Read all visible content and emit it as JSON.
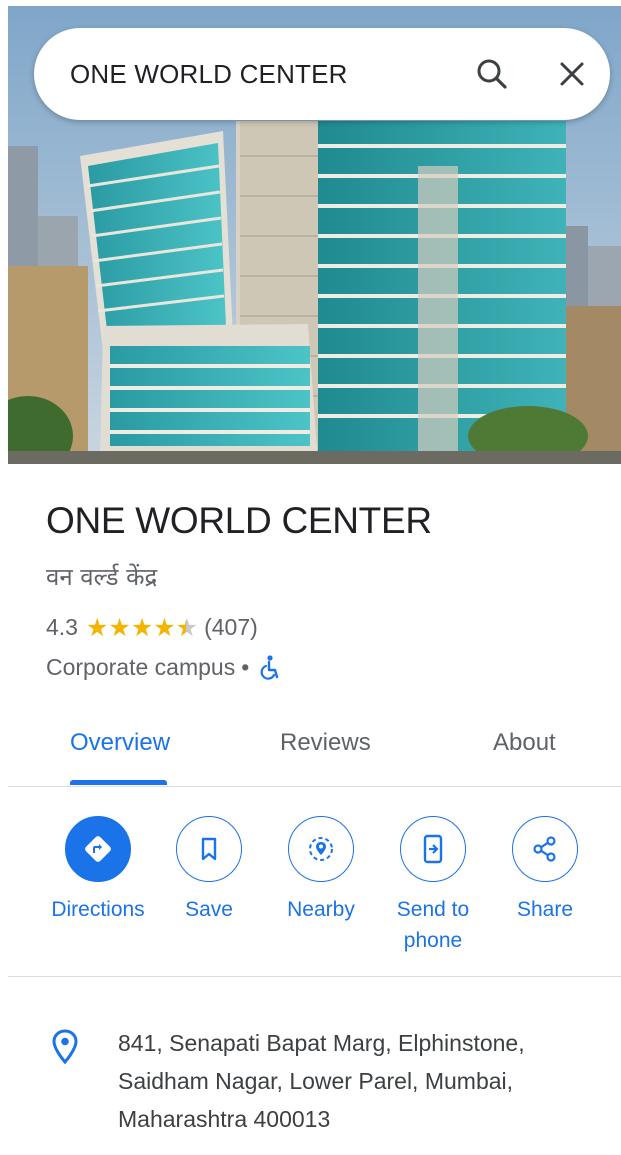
{
  "search": {
    "query": "ONE WORLD CENTER"
  },
  "place": {
    "name": "ONE WORLD CENTER",
    "local_name": "वन वर्ल्ड केंद्र",
    "rating": "4.3",
    "stars": 4.3,
    "review_count": "(407)",
    "category": "Corporate campus",
    "separator": "•",
    "wheelchair_accessible": true
  },
  "tabs": [
    {
      "label": "Overview",
      "active": true
    },
    {
      "label": "Reviews",
      "active": false
    },
    {
      "label": "About",
      "active": false
    }
  ],
  "actions": [
    {
      "label": "Directions",
      "icon": "directions-icon",
      "filled": true
    },
    {
      "label": "Save",
      "icon": "bookmark-icon",
      "filled": false
    },
    {
      "label": "Nearby",
      "icon": "nearby-icon",
      "filled": false
    },
    {
      "label": "Send to phone",
      "icon": "send-to-phone-icon",
      "filled": false
    },
    {
      "label": "Share",
      "icon": "share-icon",
      "filled": false
    }
  ],
  "address": {
    "icon": "location-pin-icon",
    "text": "841, Senapati Bapat Marg, Elphinstone, Saidham Nagar, Lower Parel, Mumbai, Maharashtra 400013"
  },
  "colors": {
    "accent": "#1a73e8",
    "star": "#f4b400",
    "secondary_text": "#5f6368"
  }
}
